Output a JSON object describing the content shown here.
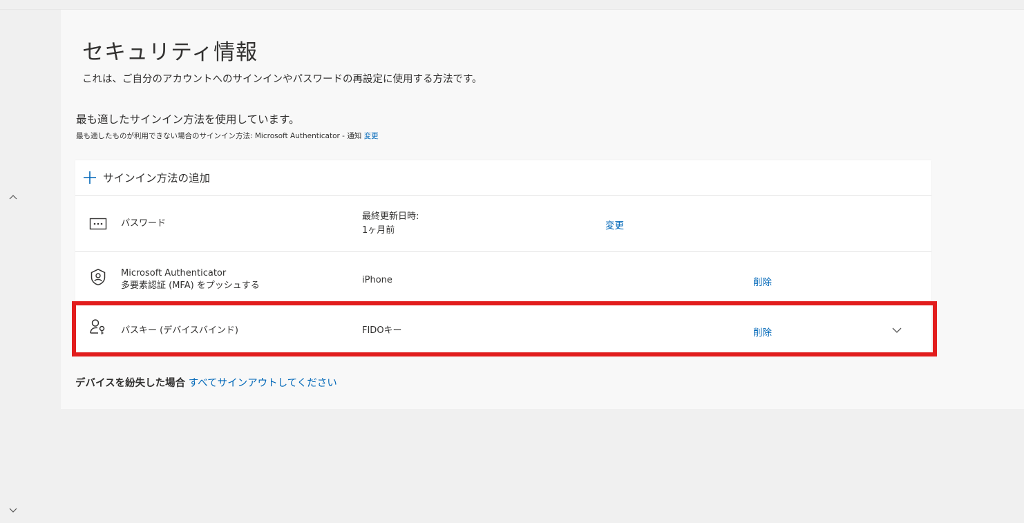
{
  "page": {
    "title": "セキュリティ情報",
    "subtitle": "これは、ご自分のアカウントへのサインインやパスワードの再設定に使用する方法です。"
  },
  "default_method": {
    "heading": "最も適したサインイン方法を使用しています。",
    "fallback_text": "最も適したものが利用できない場合のサインイン方法: Microsoft Authenticator - 通知",
    "change_link": "変更"
  },
  "methods": {
    "add_label": "サインイン方法の追加",
    "password": {
      "name": "パスワード",
      "detail_label": "最終更新日時:",
      "detail_value": "1ヶ月前",
      "action": "変更"
    },
    "authenticator": {
      "name": "Microsoft Authenticator",
      "subname": "多要素認証 (MFA) をプッシュする",
      "detail": "iPhone",
      "action": "削除"
    },
    "passkey": {
      "name": "パスキー (デバイスバインド)",
      "detail": "FIDOキー",
      "action": "削除"
    }
  },
  "lost_device": {
    "label": "デバイスを紛失した場合",
    "link": "すべてサインアウトしてください"
  },
  "colors": {
    "link": "#0067b8",
    "highlight": "#e21d1d",
    "panel": "#f8f8f8",
    "card": "#ffffff"
  },
  "icons": {
    "add": "plus-icon",
    "password": "password-dots-icon",
    "authenticator": "authenticator-icon",
    "passkey": "passkey-icon",
    "expand": "chevron-down-icon",
    "scroll_up": "chevron-up-icon",
    "scroll_down": "chevron-down-icon"
  }
}
